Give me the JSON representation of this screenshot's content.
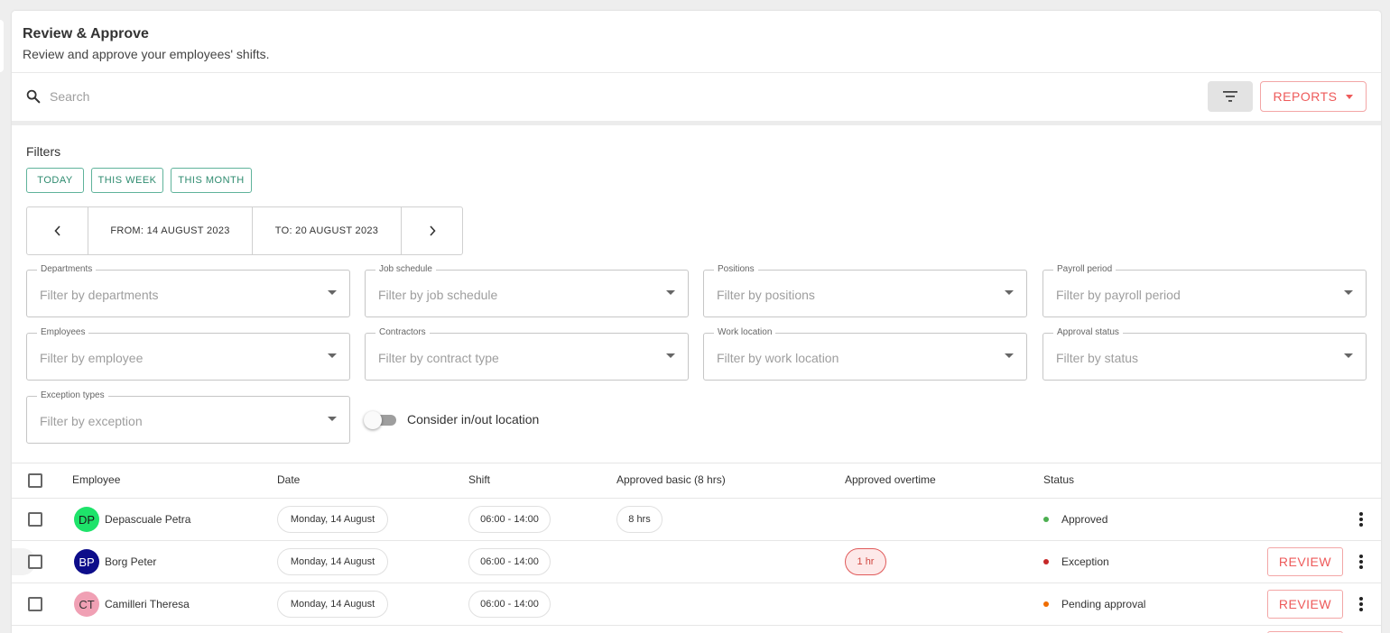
{
  "header": {
    "title": "Review & Approve",
    "subtitle": "Review and approve your employees' shifts."
  },
  "search": {
    "placeholder": "Search",
    "value": ""
  },
  "toolbar": {
    "reports_label": "REPORTS"
  },
  "filters": {
    "title": "Filters",
    "quick": [
      "TODAY",
      "THIS WEEK",
      "THIS MONTH"
    ],
    "date_from": "FROM: 14 AUGUST 2023",
    "date_to": "TO: 20 AUGUST 2023",
    "fields": [
      {
        "label": "Departments",
        "placeholder": "Filter by departments"
      },
      {
        "label": "Job schedule",
        "placeholder": "Filter by job schedule"
      },
      {
        "label": "Positions",
        "placeholder": "Filter by positions"
      },
      {
        "label": "Payroll period",
        "placeholder": "Filter by payroll period"
      },
      {
        "label": "Employees",
        "placeholder": "Filter by employee"
      },
      {
        "label": "Contractors",
        "placeholder": "Filter by contract type"
      },
      {
        "label": "Work location",
        "placeholder": "Filter by work location"
      },
      {
        "label": "Approval status",
        "placeholder": "Filter by status"
      },
      {
        "label": "Exception types",
        "placeholder": "Filter by exception"
      }
    ],
    "toggle_label": "Consider in/out location"
  },
  "table": {
    "columns": {
      "employee": "Employee",
      "date": "Date",
      "shift": "Shift",
      "approved_basic": "Approved basic (8 hrs)",
      "approved_overtime": "Approved overtime",
      "status": "Status"
    },
    "review_label": "REVIEW",
    "rows": [
      {
        "initials": "DP",
        "name": "Depascuale Petra",
        "avatar_color": "#1ee36a",
        "avatar_text": "#1a1a1a",
        "date": "Monday, 14 August",
        "shift": "06:00 - 14:00",
        "basic": "8 hrs",
        "overtime": "",
        "status": "Approved",
        "status_color": "#4caf50"
      },
      {
        "initials": "BP",
        "name": "Borg Peter",
        "avatar_color": "#0d0d8a",
        "avatar_text": "#ffffff",
        "date": "Monday, 14 August",
        "shift": "06:00 - 14:00",
        "basic": "",
        "overtime": "1 hr",
        "status": "Exception",
        "status_color": "#c62828"
      },
      {
        "initials": "CT",
        "name": "Camilleri Theresa",
        "avatar_color": "#f0a0b4",
        "avatar_text": "#333333",
        "date": "Monday, 14 August",
        "shift": "06:00 - 14:00",
        "basic": "",
        "overtime": "",
        "status": "Pending approval",
        "status_color": "#ef6c00"
      }
    ]
  },
  "colors": {
    "accent": "#ee5a5a",
    "quick_filter": "#2e8b6f"
  }
}
